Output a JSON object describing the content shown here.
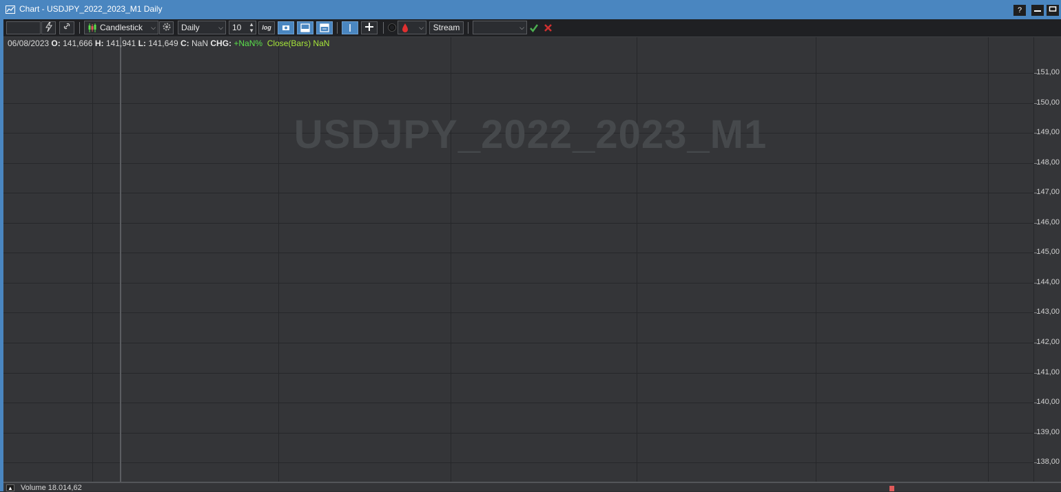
{
  "window": {
    "title": "Chart - USDJPY_2022_2023_M1 Daily",
    "help_label": "?",
    "minimize_label": "—",
    "maximize_label": "▭"
  },
  "toolbar": {
    "symbol_value": "",
    "chart_type": "Candlestick",
    "timeframe": "Daily",
    "bar_count": "10",
    "log_label": "log",
    "stream_label": "Stream",
    "order_value": ""
  },
  "info": {
    "date": "06/08/2023",
    "open_label": "O:",
    "open": "141,666",
    "high_label": "H:",
    "high": "141,941",
    "low_label": "L:",
    "low": "141,649",
    "close_label": "C:",
    "close": "NaN",
    "chg_label": "CHG:",
    "chg": "+NaN%",
    "indicator": "Close(Bars) NaN"
  },
  "watermark": "USDJPY_2022_2023_M1",
  "price_axis": {
    "ticks": [
      "151,00",
      "150,00",
      "149,00",
      "148,00",
      "147,00",
      "146,00",
      "145,00",
      "144,00",
      "143,00",
      "142,00",
      "141,00",
      "140,00",
      "139,00",
      "138,00"
    ]
  },
  "volume": {
    "label": "Volume 18.014,62",
    "collapse_label": "▲"
  },
  "colors": {
    "titlebar": "#4a86c0",
    "chart_bg": "#343538",
    "up": "#5be04c",
    "down": "#e05a5a"
  }
}
